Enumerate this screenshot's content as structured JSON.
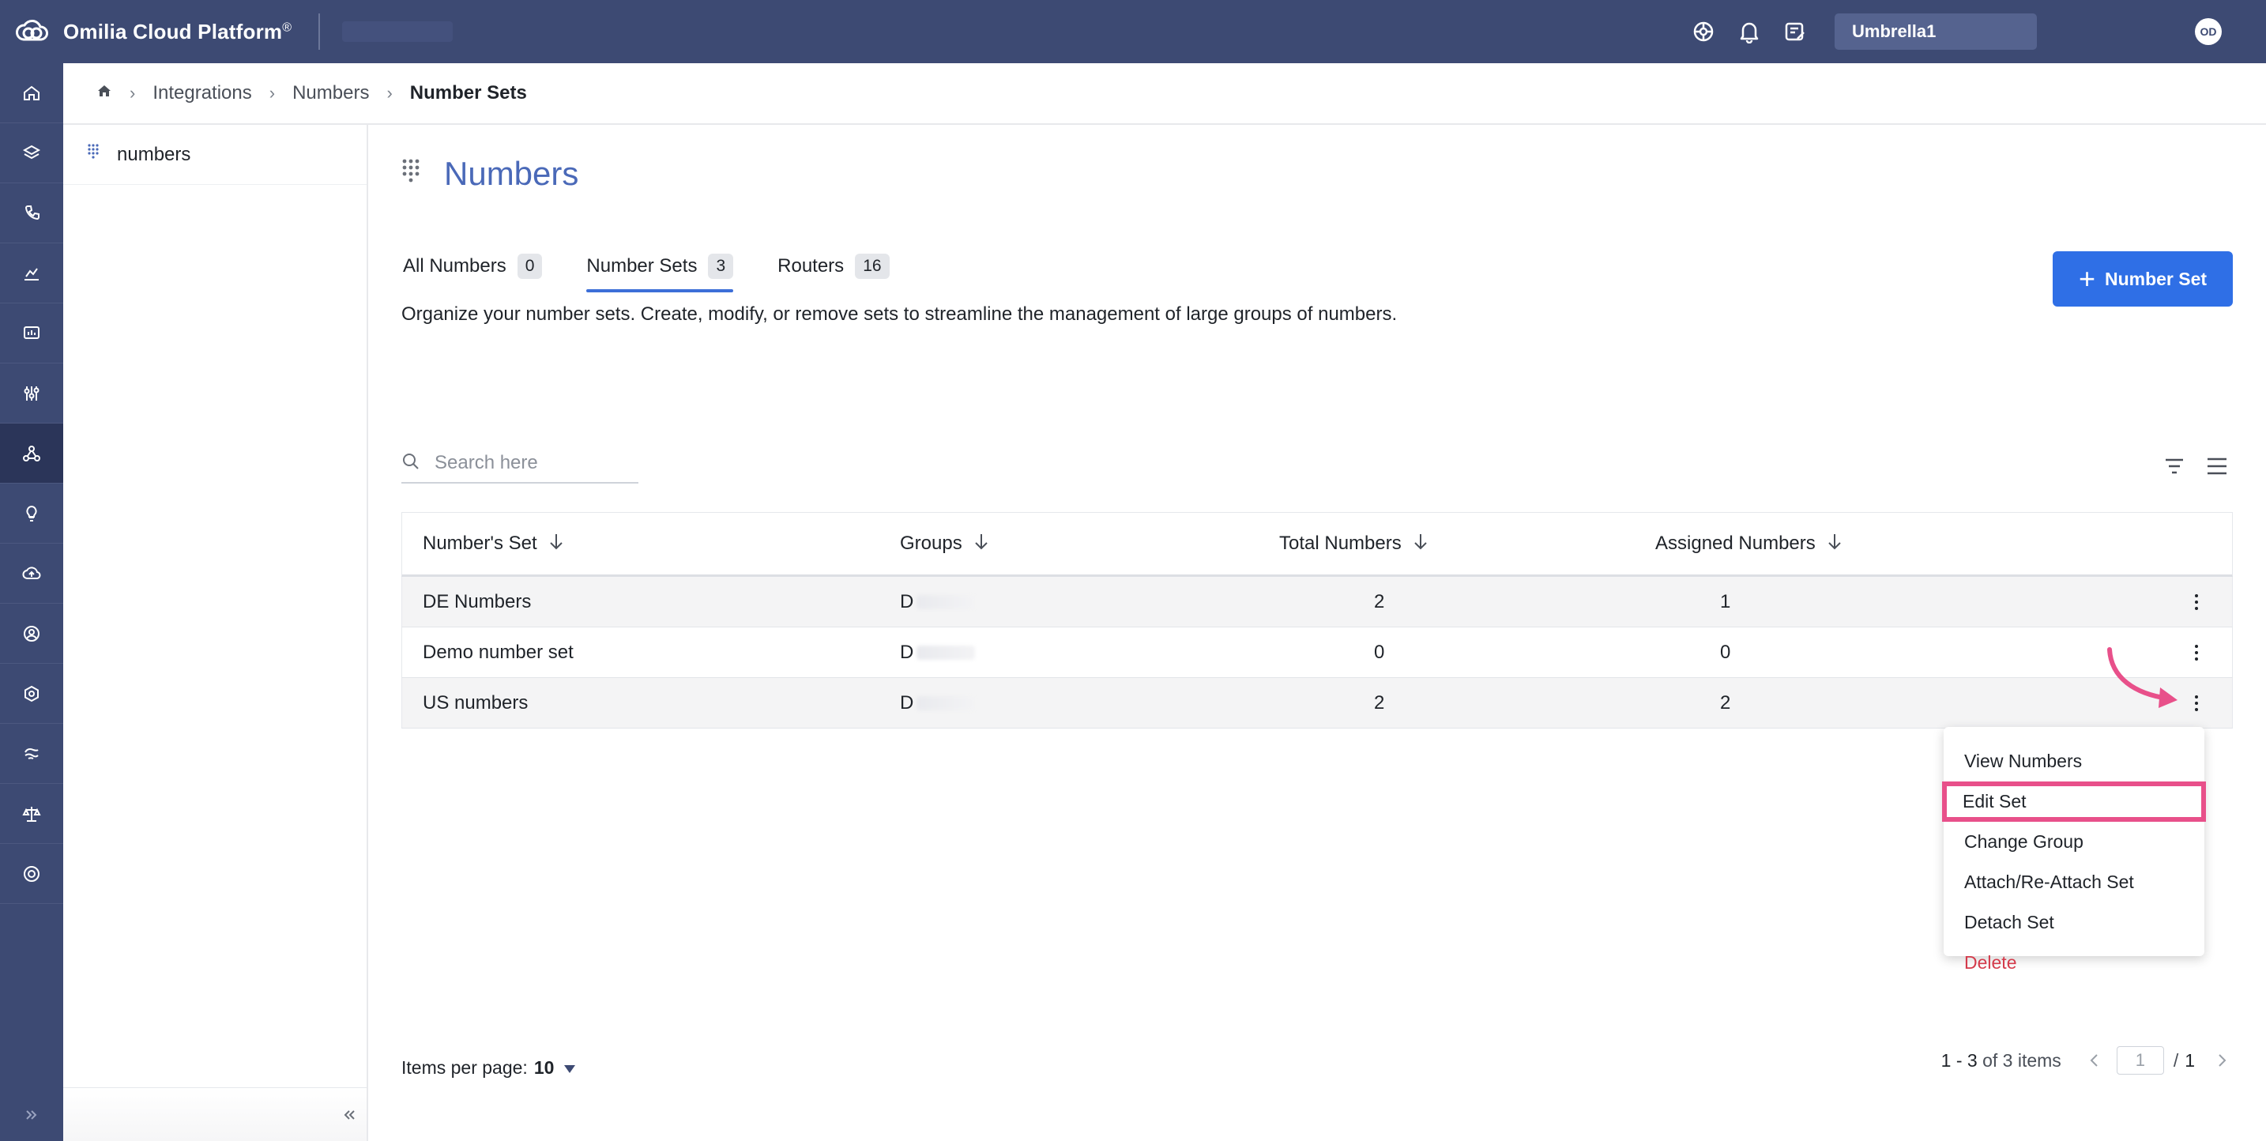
{
  "app": {
    "title": "Omilia Cloud Platform",
    "trademark": "®",
    "tenant": "Umbrella1",
    "avatar_initials": "OD"
  },
  "breadcrumb": [
    "Integrations",
    "Numbers",
    "Number Sets"
  ],
  "left_panel": {
    "item": "numbers"
  },
  "page": {
    "title": "Numbers",
    "description": "Organize your number sets. Create, modify, or remove sets to streamline the management of large groups of numbers.",
    "add_button": "Number Set"
  },
  "tabs": [
    {
      "label": "All Numbers",
      "count": "0"
    },
    {
      "label": "Number Sets",
      "count": "3",
      "active": true
    },
    {
      "label": "Routers",
      "count": "16"
    }
  ],
  "search": {
    "placeholder": "Search here"
  },
  "table": {
    "columns": [
      "Number's Set",
      "Groups",
      "Total Numbers",
      "Assigned Numbers"
    ],
    "rows": [
      {
        "name": "DE Numbers",
        "group_prefix": "D",
        "total": "2",
        "assigned": "1"
      },
      {
        "name": "Demo number set",
        "group_prefix": "D",
        "total": "0",
        "assigned": "0"
      },
      {
        "name": "US numbers",
        "group_prefix": "D",
        "total": "2",
        "assigned": "2"
      }
    ]
  },
  "context_menu": {
    "items": [
      "View Numbers",
      "Edit Set",
      "Change Group",
      "Attach/Re-Attach Set",
      "Detach Set",
      "Delete"
    ],
    "highlighted": "Edit Set",
    "highlight_color": "#e8508a"
  },
  "pagination": {
    "items_per_page_label": "Items per page:",
    "items_per_page": "10",
    "range": "1 - 3",
    "of_label": "of 3 items",
    "current_page": "1",
    "total_pages": "1"
  },
  "colors": {
    "sidebar": "#3d4a73",
    "primary": "#2f6fe6",
    "title": "#4a69b8",
    "danger": "#d43b4b"
  }
}
